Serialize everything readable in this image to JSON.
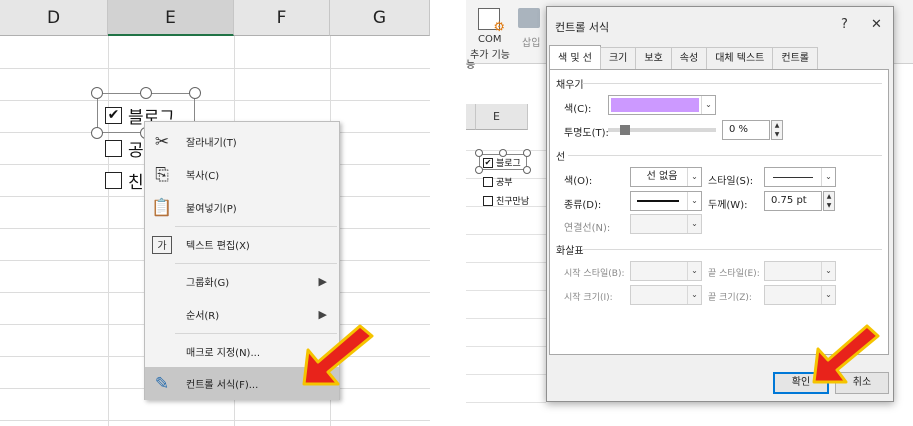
{
  "left": {
    "columns": [
      "D",
      "E",
      "F",
      "G"
    ],
    "checkboxes": [
      {
        "label": "블로그",
        "checked": true,
        "mark": "✔"
      },
      {
        "label": "공",
        "checked": false
      },
      {
        "label": "친",
        "checked": false
      }
    ],
    "context_menu": [
      {
        "label": "잘라내기(T)",
        "icon": "scissors-icon",
        "glyph": "✂"
      },
      {
        "label": "복사(C)",
        "icon": "copy-icon",
        "glyph": "⎘"
      },
      {
        "label": "붙여넣기(P)",
        "icon": "paste-icon",
        "glyph": "📋"
      },
      {
        "label": "텍스트 편집(X)",
        "icon": "edit-text-icon",
        "glyph": "가"
      },
      {
        "label": "그룹화(G)",
        "icon": "",
        "submenu": true
      },
      {
        "label": "순서(R)",
        "icon": "",
        "submenu": true
      },
      {
        "label": "매크로 지정(N)...",
        "icon": ""
      },
      {
        "label": "컨트롤 서식(F)...",
        "icon": "format-control-icon",
        "glyph": "✎",
        "highlighted": true
      }
    ],
    "submenu_arrow": "▶"
  },
  "right": {
    "ribbon": {
      "com_label": "COM",
      "addin_label": "추가 기능",
      "insert_label": "삽입",
      "extra_label": "능"
    },
    "sheet": {
      "column": "E",
      "checkboxes": [
        {
          "label": "블로그",
          "checked": true,
          "mark": "✔"
        },
        {
          "label": "공부",
          "checked": false
        },
        {
          "label": "친구만남",
          "checked": false
        }
      ]
    },
    "dialog": {
      "title": "컨트롤 서식",
      "help": "?",
      "close": "✕",
      "tabs": [
        "색 및 선",
        "크기",
        "보호",
        "속성",
        "대체 텍스트",
        "컨트롤"
      ],
      "fill_section": "채우기",
      "fill_color_label": "색(C):",
      "fill_color": "#cc99ff",
      "transparency_label": "투명도(T):",
      "transparency_value": "0 %",
      "line_section": "선",
      "line_color_label": "색(O):",
      "line_color_value": "선 없음",
      "style_label": "스타일(S):",
      "dash_label": "종류(D):",
      "weight_label": "두께(W):",
      "weight_value": "0.75 pt",
      "connector_label": "연결선(N):",
      "arrows_section": "화살표",
      "begin_style_label": "시작 스타일(B):",
      "end_style_label": "끝 스타일(E):",
      "begin_size_label": "시작 크기(I):",
      "end_size_label": "끝 크기(Z):",
      "ok_label": "확인",
      "cancel_label": "취소"
    }
  },
  "colors": {
    "arrow_fill": "#e8231b",
    "arrow_stroke": "#f5c400",
    "accent": "#0078d7"
  }
}
